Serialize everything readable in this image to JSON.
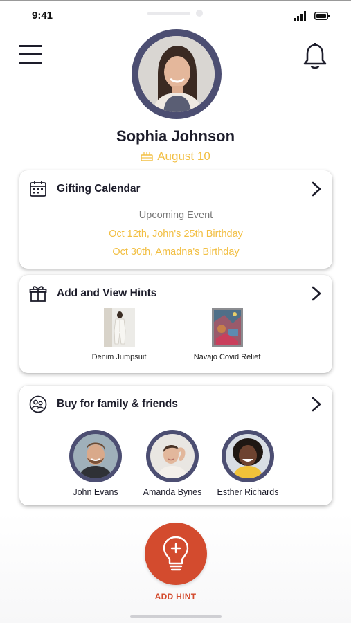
{
  "status_bar": {
    "time": "9:41"
  },
  "profile": {
    "name": "Sophia Johnson",
    "birthday": "August 10"
  },
  "gifting_calendar": {
    "title": "Gifting Calendar",
    "subtitle": "Upcoming Event",
    "events": [
      "Oct 12th, John's 25th Birthday",
      "Oct 30th, Amadna's Birthday"
    ]
  },
  "hints": {
    "title": "Add and View Hints",
    "items": [
      {
        "label": "Denim Jumpsuit"
      },
      {
        "label": "Navajo Covid Relief"
      }
    ]
  },
  "family": {
    "title": "Buy for family & friends",
    "people": [
      {
        "name": "John Evans"
      },
      {
        "name": "Amanda Bynes"
      },
      {
        "name": "Esther Richards"
      }
    ]
  },
  "add_hint": {
    "label": "ADD HINT"
  },
  "colors": {
    "accent_yellow": "#f2bf43",
    "avatar_ring": "#4c4e72",
    "primary_red": "#d34b2e"
  }
}
